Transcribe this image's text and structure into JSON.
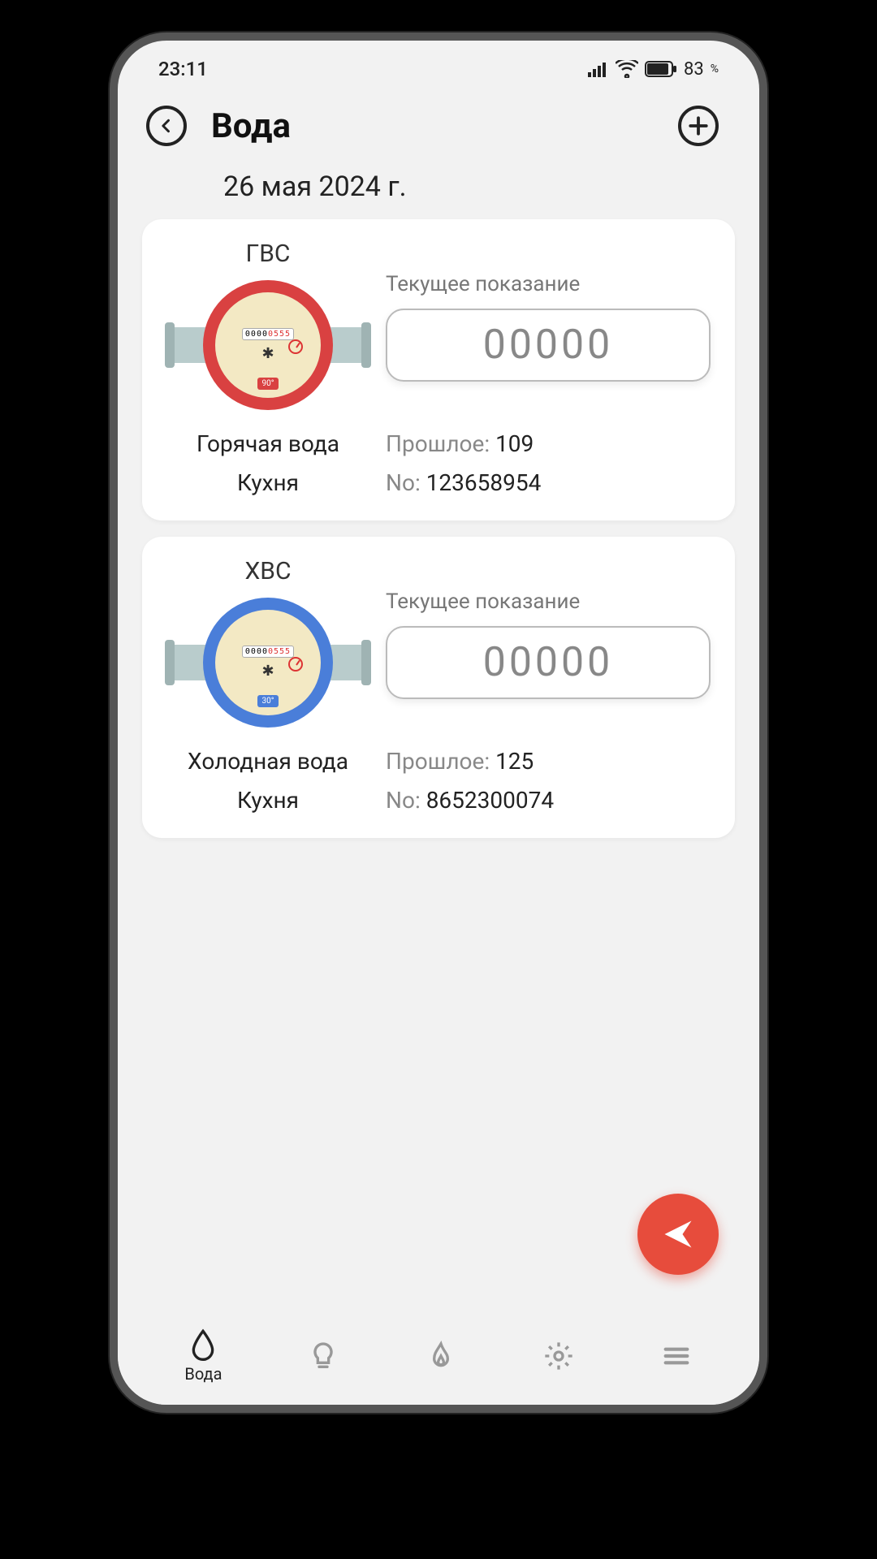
{
  "status": {
    "time": "23:11",
    "battery_pct": "83",
    "battery_sym": "%"
  },
  "header": {
    "title": "Вода"
  },
  "date_label": "26 мая 2024 г.",
  "reading_label": "Текущее показание",
  "previous_label": "Прошлое:",
  "serial_label": "No:",
  "meters": [
    {
      "abbr": "ГВС",
      "name": "Горячая вода",
      "location": "Кухня",
      "placeholder": "00000",
      "previous": "109",
      "serial": "123658954",
      "temp": "90°",
      "color": "hot"
    },
    {
      "abbr": "ХВС",
      "name": "Холодная вода",
      "location": "Кухня",
      "placeholder": "00000",
      "previous": "125",
      "serial": "8652300074",
      "temp": "30°",
      "color": "cold"
    }
  ],
  "nav": {
    "water": "Вода"
  }
}
